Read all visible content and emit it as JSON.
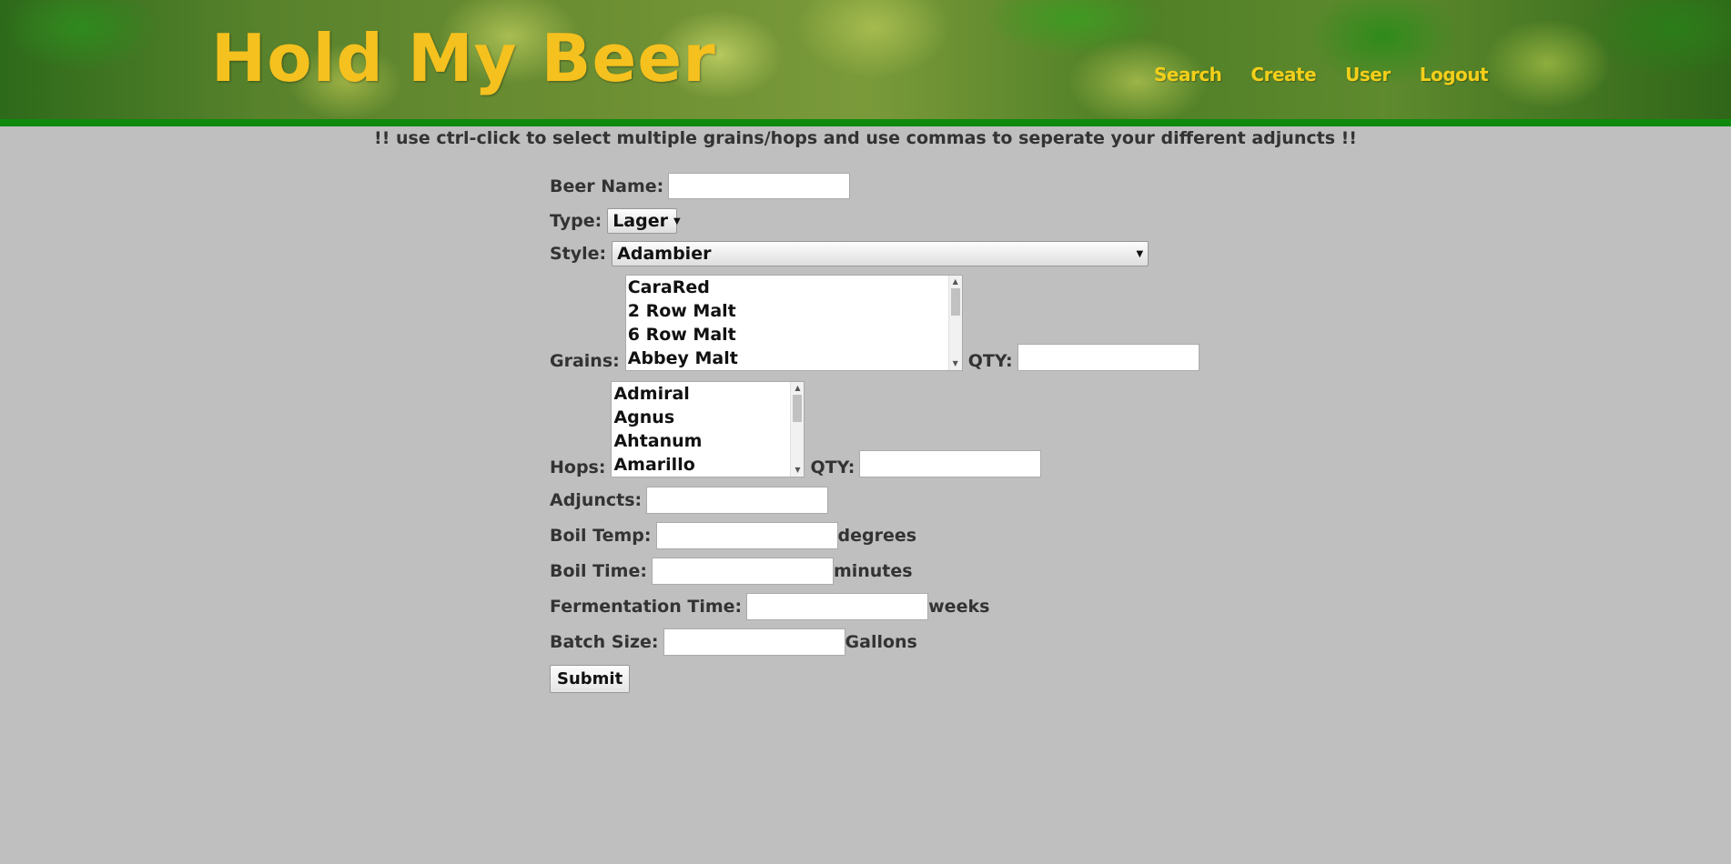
{
  "header": {
    "site_title": "Hold My Beer",
    "nav": [
      "Search",
      "Create",
      "User",
      "Logout"
    ]
  },
  "notice": "!! use ctrl-click to select multiple grains/hops and use commas to seperate your different adjuncts !!",
  "form": {
    "beer_name_label": "Beer Name:",
    "beer_name_value": "",
    "type_label": "Type:",
    "type_value": "Lager",
    "style_label": "Style:",
    "style_value": "Adambier",
    "grains_label": "Grains:",
    "grains_options": [
      "CaraRed",
      "2 Row Malt",
      "6 Row Malt",
      "Abbey Malt"
    ],
    "grains_qty_label": "QTY:",
    "hops_label": "Hops:",
    "hops_options": [
      "Admiral",
      "Agnus",
      "Ahtanum",
      "Amarillo"
    ],
    "hops_qty_label": "QTY:",
    "adjuncts_label": "Adjuncts:",
    "boil_temp_label": "Boil Temp:",
    "boil_temp_unit": "degrees",
    "boil_time_label": "Boil Time:",
    "boil_time_unit": "minutes",
    "fermentation_time_label": "Fermentation Time:",
    "fermentation_time_unit": "weeks",
    "batch_size_label": "Batch Size:",
    "batch_size_unit": "Gallons",
    "submit_label": "Submit"
  },
  "colors": {
    "page_background": "#bfbfbf",
    "title_color": "#f5c11e",
    "nav_color": "#f3cf1a",
    "header_bar": "#0f8a0f"
  }
}
